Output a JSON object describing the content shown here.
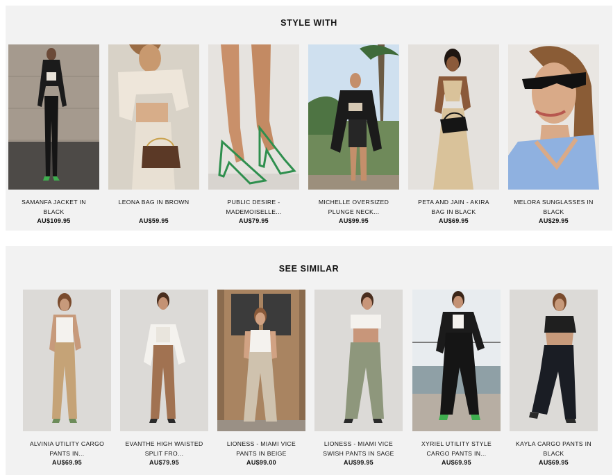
{
  "style_with": {
    "title": "STYLE WITH",
    "products": [
      {
        "name": "SAMANFA JACKET IN BLACK",
        "price": "AU$109.95",
        "image": "model-black-jacket-photo"
      },
      {
        "name": "LEONA BAG IN BROWN",
        "price": "AU$59.95",
        "image": "model-brown-bag-photo"
      },
      {
        "name": "PUBLIC DESIRE - MADEMOISELLE...",
        "price": "AU$79.95",
        "image": "green-heels-photo"
      },
      {
        "name": "MICHELLE OVERSIZED PLUNGE NECK...",
        "price": "AU$99.95",
        "image": "model-blazer-outdoor-photo"
      },
      {
        "name": "PETA AND JAIN - AKIRA BAG IN BLACK",
        "price": "AU$69.95",
        "image": "model-black-bag-photo"
      },
      {
        "name": "MELORA SUNGLASSES IN BLACK",
        "price": "AU$29.95",
        "image": "model-sunglasses-photo"
      }
    ]
  },
  "see_similar": {
    "title": "SEE SIMILAR",
    "products": [
      {
        "name": "ALVINIA UTILITY CARGO PANTS IN...",
        "price": "AU$69.95",
        "image": "model-tan-cargo-photo"
      },
      {
        "name": "EVANTHE HIGH WAISTED SPLIT FRO...",
        "price": "AU$79.95",
        "image": "model-brown-pants-photo"
      },
      {
        "name": "LIONESS - MIAMI VICE PANTS IN BEIGE",
        "price": "AU$99.00",
        "image": "model-beige-pants-door-photo"
      },
      {
        "name": "LIONESS - MIAMI VICE SWISH PANTS IN SAGE",
        "price": "AU$99.95",
        "image": "model-sage-pants-photo"
      },
      {
        "name": "XYRIEL UTILITY STYLE CARGO PANTS IN...",
        "price": "AU$69.95",
        "image": "model-black-cargo-outdoor-photo"
      },
      {
        "name": "KAYLA CARGO PANTS IN BLACK",
        "price": "AU$69.95",
        "image": "model-black-cargo-photo"
      }
    ]
  }
}
